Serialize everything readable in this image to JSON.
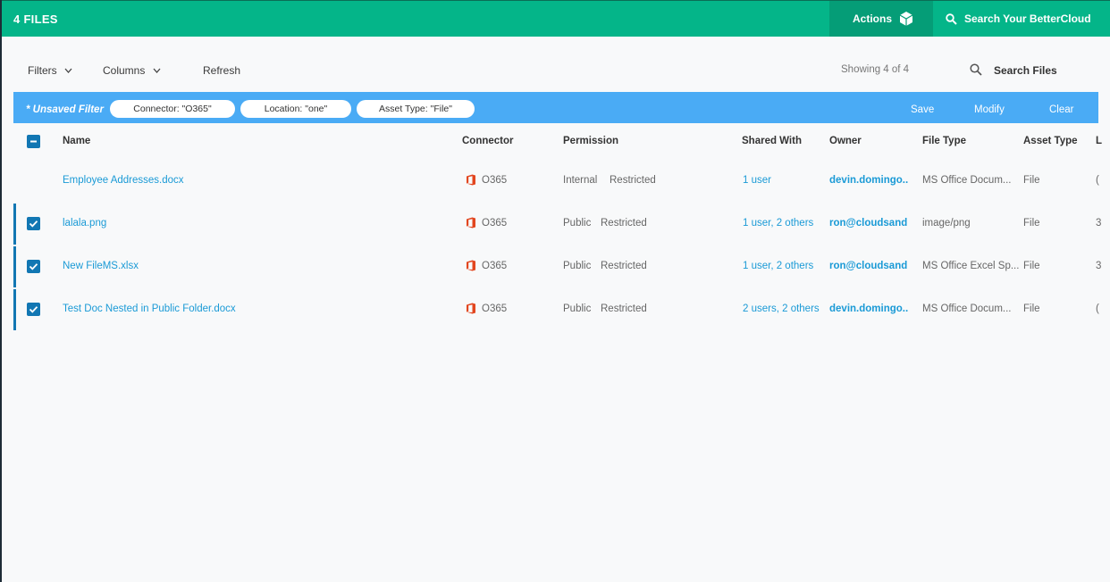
{
  "topbar": {
    "title": "4 FILES",
    "actions_label": "Actions",
    "search_label": "Search Your BetterCloud",
    "brand_color": "#04b589"
  },
  "toolbar": {
    "filters_label": "Filters",
    "columns_label": "Columns",
    "refresh_label": "Refresh",
    "showing": "Showing 4 of 4",
    "search_files": "Search Files"
  },
  "filterbar": {
    "unsaved": "* Unsaved Filter",
    "pills": [
      "Connector: \"O365\"",
      "Location: \"one\"",
      "Asset Type: \"File\""
    ],
    "save": "Save",
    "modify": "Modify",
    "clear": "Clear"
  },
  "columns": [
    "Name",
    "Connector",
    "Permission",
    "Shared With",
    "Owner",
    "File Type",
    "Asset Type",
    "L"
  ],
  "rows": [
    {
      "name": "Employee Addresses.docx",
      "connector": "O365",
      "perm1": "Internal",
      "perm2": "Restricted",
      "shared": "1 user",
      "owner": "devin.domingo...",
      "filetype": "MS Office Docum...",
      "asset": "File",
      "extra": "(",
      "selected": false
    },
    {
      "name": "lalala.png",
      "connector": "O365",
      "perm1": "Public",
      "perm2": "Restricted",
      "shared": "1 user, 2 others",
      "owner": "ron@cloudsand...",
      "filetype": "image/png",
      "asset": "File",
      "extra": "3",
      "selected": true
    },
    {
      "name": "New FileMS.xlsx",
      "connector": "O365",
      "perm1": "Public",
      "perm2": "Restricted",
      "shared": "1 user, 2 others",
      "owner": "ron@cloudsand...",
      "filetype": "MS Office Excel Sp...",
      "asset": "File",
      "extra": "3",
      "selected": true
    },
    {
      "name": "Test Doc Nested in Public Folder.docx",
      "connector": "O365",
      "perm1": "Public",
      "perm2": "Restricted",
      "shared": "2 users, 2 others",
      "owner": "devin.domingo...",
      "filetype": "MS Office Docum...",
      "asset": "File",
      "extra": "(",
      "selected": true
    }
  ]
}
